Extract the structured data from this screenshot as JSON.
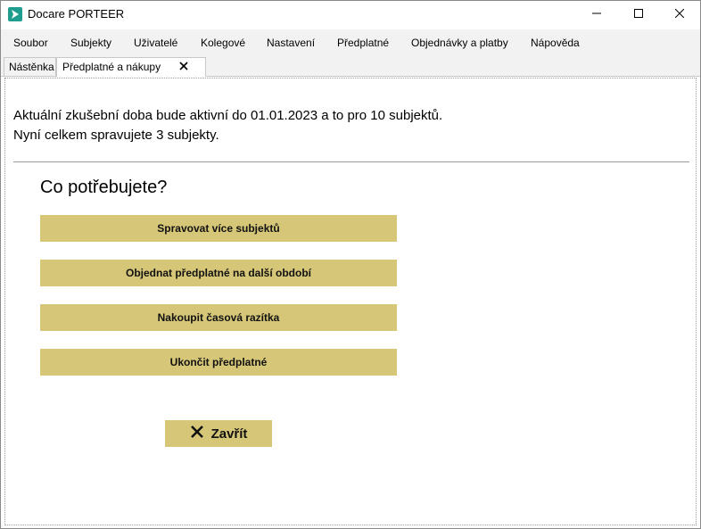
{
  "window": {
    "title": "Docare PORTEER"
  },
  "menu": {
    "items": [
      {
        "label": "Soubor"
      },
      {
        "label": "Subjekty"
      },
      {
        "label": "Uživatelé"
      },
      {
        "label": "Kolegové"
      },
      {
        "label": "Nastavení"
      },
      {
        "label": "Předplatné"
      },
      {
        "label": "Objednávky a platby"
      },
      {
        "label": "Nápověda"
      }
    ]
  },
  "tabs": [
    {
      "label": "Nástěnka"
    },
    {
      "label": "Předplatné a nákupy"
    }
  ],
  "main": {
    "info_line1": "Aktuální zkušební doba bude aktivní do 01.01.2023 a to pro 10 subjektů.",
    "info_line2": "Nyní celkem spravujete 3 subjekty.",
    "heading": "Co potřebujete?",
    "actions": [
      {
        "label": "Spravovat více subjektů"
      },
      {
        "label": "Objednat předplatné na další období"
      },
      {
        "label": "Nakoupit časová razítka"
      },
      {
        "label": "Ukončit předplatné"
      }
    ],
    "close_label": "Zavřít"
  },
  "colors": {
    "button_bg": "#d6c677",
    "app_icon": "#1f9d8f"
  },
  "icons": {
    "app": "docare-logo-icon",
    "minimize": "minimize-icon",
    "maximize": "maximize-icon",
    "close": "close-icon",
    "tab_close": "tab-close-icon",
    "close_button": "x-icon"
  }
}
